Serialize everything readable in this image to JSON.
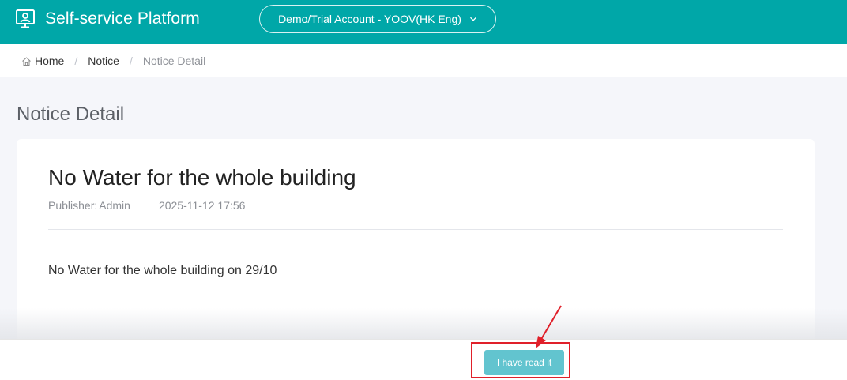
{
  "header": {
    "title": "Self-service Platform",
    "brand_icon": "monitor-user-icon",
    "account_selector": "Demo/Trial Account - YOOV(HK Eng)",
    "account_chevron_icon": "chevron-down-icon",
    "background_color": "#00a7a8"
  },
  "breadcrumb": {
    "home_icon": "home-icon",
    "home": "Home",
    "separator": "/",
    "notice": "Notice",
    "current": "Notice Detail"
  },
  "page": {
    "title": "Notice Detail"
  },
  "notice": {
    "title": "No Water for the whole building",
    "publisher_label": "Publisher:",
    "publisher_name": "Admin",
    "date": "2025-11-12 17:56",
    "body": "No Water for the whole building on 29/10"
  },
  "footer": {
    "read_button_label": "I have read it",
    "read_button_color": "#62c4cf"
  },
  "annotation": {
    "highlight_color": "#e0202a",
    "arrow_icon": "red-arrow-pointer-icon"
  }
}
